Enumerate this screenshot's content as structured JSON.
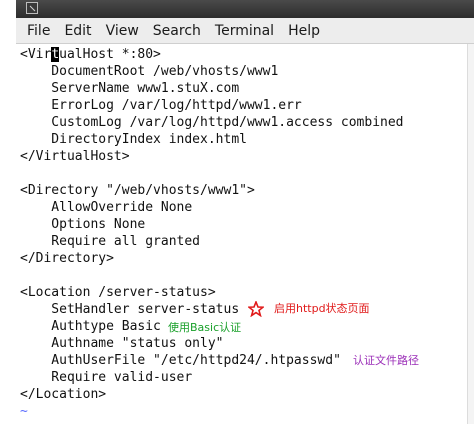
{
  "menu": [
    "File",
    "Edit",
    "View",
    "Search",
    "Terminal",
    "Help"
  ],
  "lines": [
    {
      "pre": "<Vir",
      "cur": "t",
      "post": "ualHost *:80>"
    },
    "    DocumentRoot /web/vhosts/www1",
    "    ServerName www1.stuX.com",
    "    ErrorLog /var/log/httpd/www1.err",
    "    CustomLog /var/log/httpd/www1.access combined",
    "    DirectoryIndex index.html",
    "</VirtualHost>",
    "",
    "<Directory \"/web/vhosts/www1\">",
    "    AllowOverride None",
    "    Options None",
    "    Require all granted",
    "</Directory>",
    "",
    "<Location /server-status>",
    "    SetHandler server-status",
    "    Authtype Basic",
    "    Authname \"status only\"",
    "    AuthUserFile \"/etc/httpd24/.htpasswd\"",
    "    Require valid-user",
    "</Location>"
  ],
  "tilde": "~",
  "annotations": {
    "enable_status": "启用httpd状态页面",
    "use_basic": "使用Basic认证",
    "auth_file_path": "认证文件路径"
  },
  "colors": {
    "annotation_red": "#e01919",
    "annotation_green": "#19a02a",
    "annotation_purple": "#9b2fb8",
    "tilde_blue": "#5b6cff"
  }
}
